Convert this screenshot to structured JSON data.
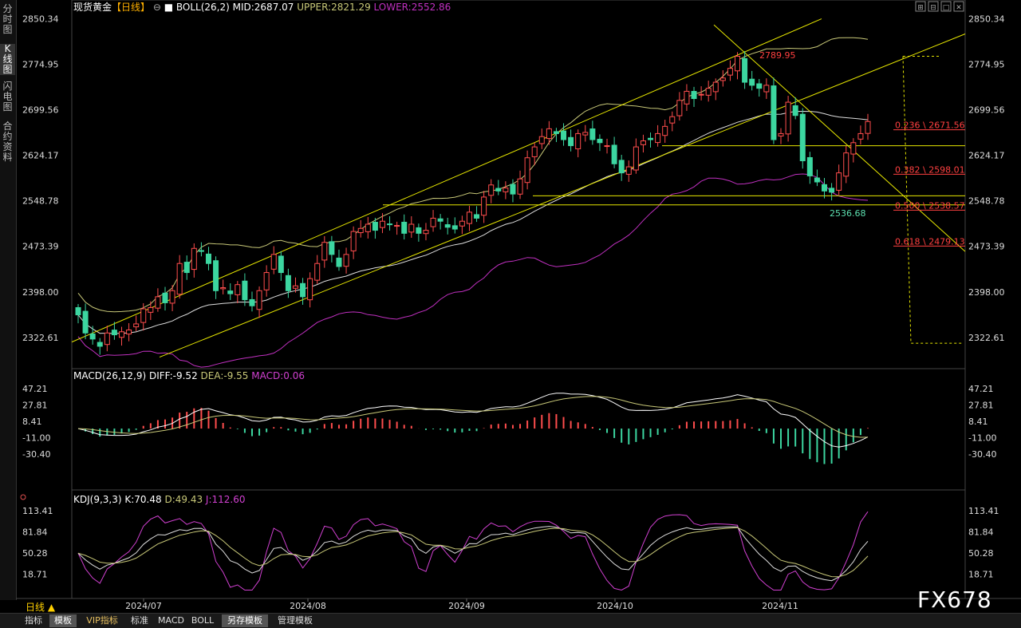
{
  "sidebar": [
    {
      "label": "分时图",
      "active": false
    },
    {
      "label": "K线图",
      "active": true
    },
    {
      "label": "闪电图",
      "active": false
    },
    {
      "label": "合约资料",
      "active": false
    }
  ],
  "header": {
    "instrument": "现货黄金",
    "period": "【日线】",
    "boll": "BOLL(26,2)",
    "mid": "MID:2687.07",
    "upper": "UPPER:2821.29",
    "lower": "LOWER:2552.86"
  },
  "macd_header": {
    "name": "MACD(26,12,9)",
    "diff": "DIFF:-9.52",
    "dea": "DEA:-9.55",
    "macd": "MACD:0.06"
  },
  "kdj_header": {
    "name": "KDJ(9,3,3)",
    "k": "K:70.48",
    "d": "D:49.43",
    "j": "J:112.60"
  },
  "period_label": "日线 ▲",
  "watermark": "FX678",
  "bottom_tabs": [
    {
      "label": "指标",
      "active": false,
      "vip": false
    },
    {
      "label": "模板",
      "active": true,
      "vip": false
    },
    {
      "label": "VIP指标",
      "active": false,
      "vip": true
    },
    {
      "label": "标准",
      "active": false,
      "vip": false
    },
    {
      "label": "MACD",
      "active": false,
      "vip": false
    },
    {
      "label": "BOLL",
      "active": false,
      "vip": false
    },
    {
      "label": "另存模板",
      "active": true,
      "vip": false
    },
    {
      "label": "管理模板",
      "active": false,
      "vip": false
    }
  ],
  "window_icons": [
    "expand-icon",
    "grid-icon",
    "window-icon",
    "close-icon"
  ],
  "colors": {
    "up": "#ff4d4d",
    "down": "#3cd6a0",
    "mid": "#dddddd",
    "upper": "#c8c878",
    "lower": "#c030c0",
    "trend": "#e6e600",
    "fib": "#ff4040",
    "k": "#dddddd",
    "d": "#c8c878",
    "j": "#d040d0"
  },
  "chart_data": [
    {
      "type": "candlestick",
      "name": "现货黄金 日线",
      "x_ticks": [
        "2024/07",
        "2024/08",
        "2024/09",
        "2024/10",
        "2024/11"
      ],
      "y_ticks": [
        "2850.34",
        "2774.95",
        "2699.56",
        "2624.17",
        "2548.78",
        "2473.39",
        "2398.00",
        "2322.61"
      ],
      "ylim": [
        2300,
        2860
      ],
      "close": [
        2360,
        2330,
        2320,
        2308,
        2330,
        2327,
        2332,
        2335,
        2345,
        2370,
        2372,
        2390,
        2380,
        2400,
        2445,
        2430,
        2470,
        2465,
        2445,
        2400,
        2405,
        2395,
        2410,
        2385,
        2375,
        2400,
        2430,
        2460,
        2430,
        2400,
        2408,
        2390,
        2420,
        2445,
        2480,
        2460,
        2440,
        2460,
        2498,
        2503,
        2510,
        2500,
        2515,
        2510,
        2508,
        2495,
        2510,
        2495,
        2500,
        2520,
        2515,
        2505,
        2502,
        2515,
        2530,
        2520,
        2555,
        2575,
        2565,
        2570,
        2560,
        2585,
        2620,
        2638,
        2655,
        2668,
        2660,
        2650,
        2640,
        2660,
        2662,
        2650,
        2645,
        2640,
        2610,
        2595,
        2605,
        2638,
        2648,
        2650,
        2660,
        2672,
        2688,
        2715,
        2730,
        2718,
        2725,
        2735,
        2745,
        2752,
        2768,
        2788,
        2745,
        2740,
        2735,
        2740,
        2650,
        2660,
        2712,
        2690,
        2615,
        2590,
        2580,
        2565,
        2563,
        2595,
        2628,
        2645,
        2660,
        2680
      ],
      "annotations": [
        {
          "text": "2789.95",
          "value": 2789.95
        },
        {
          "text": "2536.68",
          "value": 2536.68
        }
      ],
      "horizontal_levels": [
        2640,
        2557,
        2542
      ],
      "fibonacci": [
        {
          "label": "0.236 \\ 2671.56",
          "value": 2671.56
        },
        {
          "label": "0.382 \\ 2598.01",
          "value": 2598.01
        },
        {
          "label": "0.500 \\ 2538.57",
          "value": 2538.57
        },
        {
          "label": "0.618 \\ 2479.13",
          "value": 2479.13
        }
      ]
    },
    {
      "type": "macd",
      "y_ticks": [
        "47.21",
        "27.81",
        "8.41",
        "-11.00",
        "-30.40"
      ],
      "ylim": [
        -50,
        52
      ]
    },
    {
      "type": "kdj",
      "y_ticks": [
        "113.41",
        "81.84",
        "50.28",
        "18.71"
      ],
      "ylim": [
        -10,
        128
      ]
    }
  ]
}
